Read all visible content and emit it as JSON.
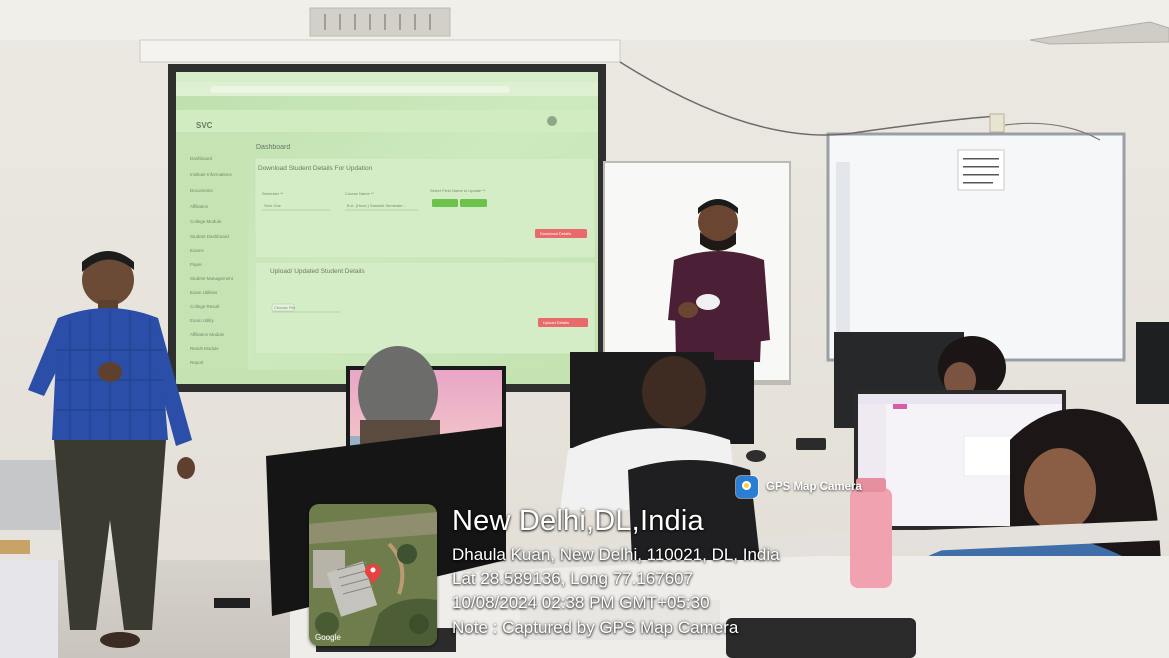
{
  "photo": {
    "description_icons": [
      "projector-screen-icon",
      "whiteboard-icon",
      "gps-camera-icon",
      "map-pin-icon"
    ]
  },
  "projected_dashboard": {
    "app_logo": "SVC",
    "page_title": "Dashboard",
    "section_download": "Download Student Details For Updation",
    "section_upload": "Upload/ Updated Student Details",
    "sidebar_items": [
      "Dashboard",
      "Institute Informations",
      "Documents",
      "Affiliation",
      "College Module",
      "Student Dashboard",
      "Exams",
      "Paper",
      "Student Management",
      "Exam Utilities",
      "College Result",
      "Exam Utility",
      "Affiliation Module",
      "Result Module",
      "Report"
    ],
    "field_semester_label": "Semester **",
    "field_semester_value": "Sem One",
    "field_course_label": "Course Name **",
    "field_course_value": "B.A. (Hons.) Sanskrit Semester...",
    "field_select_label": "Select Field Name to Update **",
    "btn_download": "Download Details",
    "btn_choose": "Choose File",
    "btn_upload": "Upload Details",
    "colors": {
      "screen_bg": "#c9e7b8",
      "button_green": "#6cc24a",
      "button_red": "#e86a6a"
    }
  },
  "gps_overlay": {
    "app_name": "GPS Map Camera",
    "city": "New Delhi,DL,India",
    "address": "Dhaula Kuan, New Delhi, 110021, DL, India",
    "lat_long": "Lat 28.589136, Long 77.167607",
    "datetime": "10/08/2024 02:38 PM GMT+05:30",
    "note": "Note : Captured by GPS Map Camera",
    "map_label": "Google",
    "colors": {
      "badge": "#2a7fd4",
      "pin": "#e84141",
      "text": "#ffffff"
    }
  }
}
